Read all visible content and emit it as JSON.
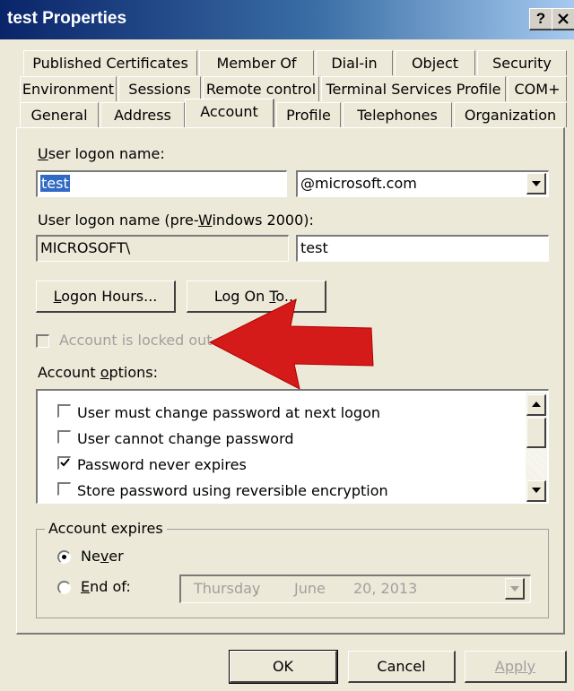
{
  "window": {
    "title": "test Properties",
    "help_label": "?",
    "close_label": "X"
  },
  "tabs": {
    "row1": [
      "Published Certificates",
      "Member Of",
      "Dial-in",
      "Object",
      "Security"
    ],
    "row2": [
      "Environment",
      "Sessions",
      "Remote control",
      "Terminal Services Profile",
      "COM+"
    ],
    "row3": [
      "General",
      "Address",
      "Account",
      "Profile",
      "Telephones",
      "Organization"
    ],
    "active": "Account"
  },
  "account": {
    "logon_name_label_u": "U",
    "logon_name_label_rest": "ser logon name:",
    "logon_name_value": "test",
    "domain_value": "@microsoft.com",
    "pre2000_label_a": "User logon name (pre-",
    "pre2000_label_u": "W",
    "pre2000_label_b": "indows 2000):",
    "pre2000_domain": "MICROSOFT\\",
    "pre2000_name": "test",
    "logon_hours_u": "L",
    "logon_hours_rest": "ogon Hours...",
    "log_on_to_a": "Log On ",
    "log_on_to_u": "T",
    "log_on_to_b": "o...",
    "locked_out_label": "Account is locked out",
    "options_label_a": "Account ",
    "options_label_u": "o",
    "options_label_b": "ptions:",
    "options": [
      {
        "label": "User must change password at next logon",
        "checked": false
      },
      {
        "label": "User cannot change password",
        "checked": false
      },
      {
        "label": "Password never expires",
        "checked": true
      },
      {
        "label": "Store password using reversible encryption",
        "checked": false
      }
    ],
    "expires_legend": "Account expires",
    "never_a": "Ne",
    "never_u": "v",
    "never_b": "er",
    "end_of_u": "E",
    "end_of_rest": "nd of:",
    "date_day": "Thursday",
    "date_sep": ",",
    "date_month": "June",
    "date_rest": "20, 2013",
    "expires_selected": "never"
  },
  "buttons": {
    "ok": "OK",
    "cancel": "Cancel",
    "apply": "Apply"
  },
  "colors": {
    "annotation_arrow": "#d51a1a",
    "selection": "#316ac5"
  }
}
